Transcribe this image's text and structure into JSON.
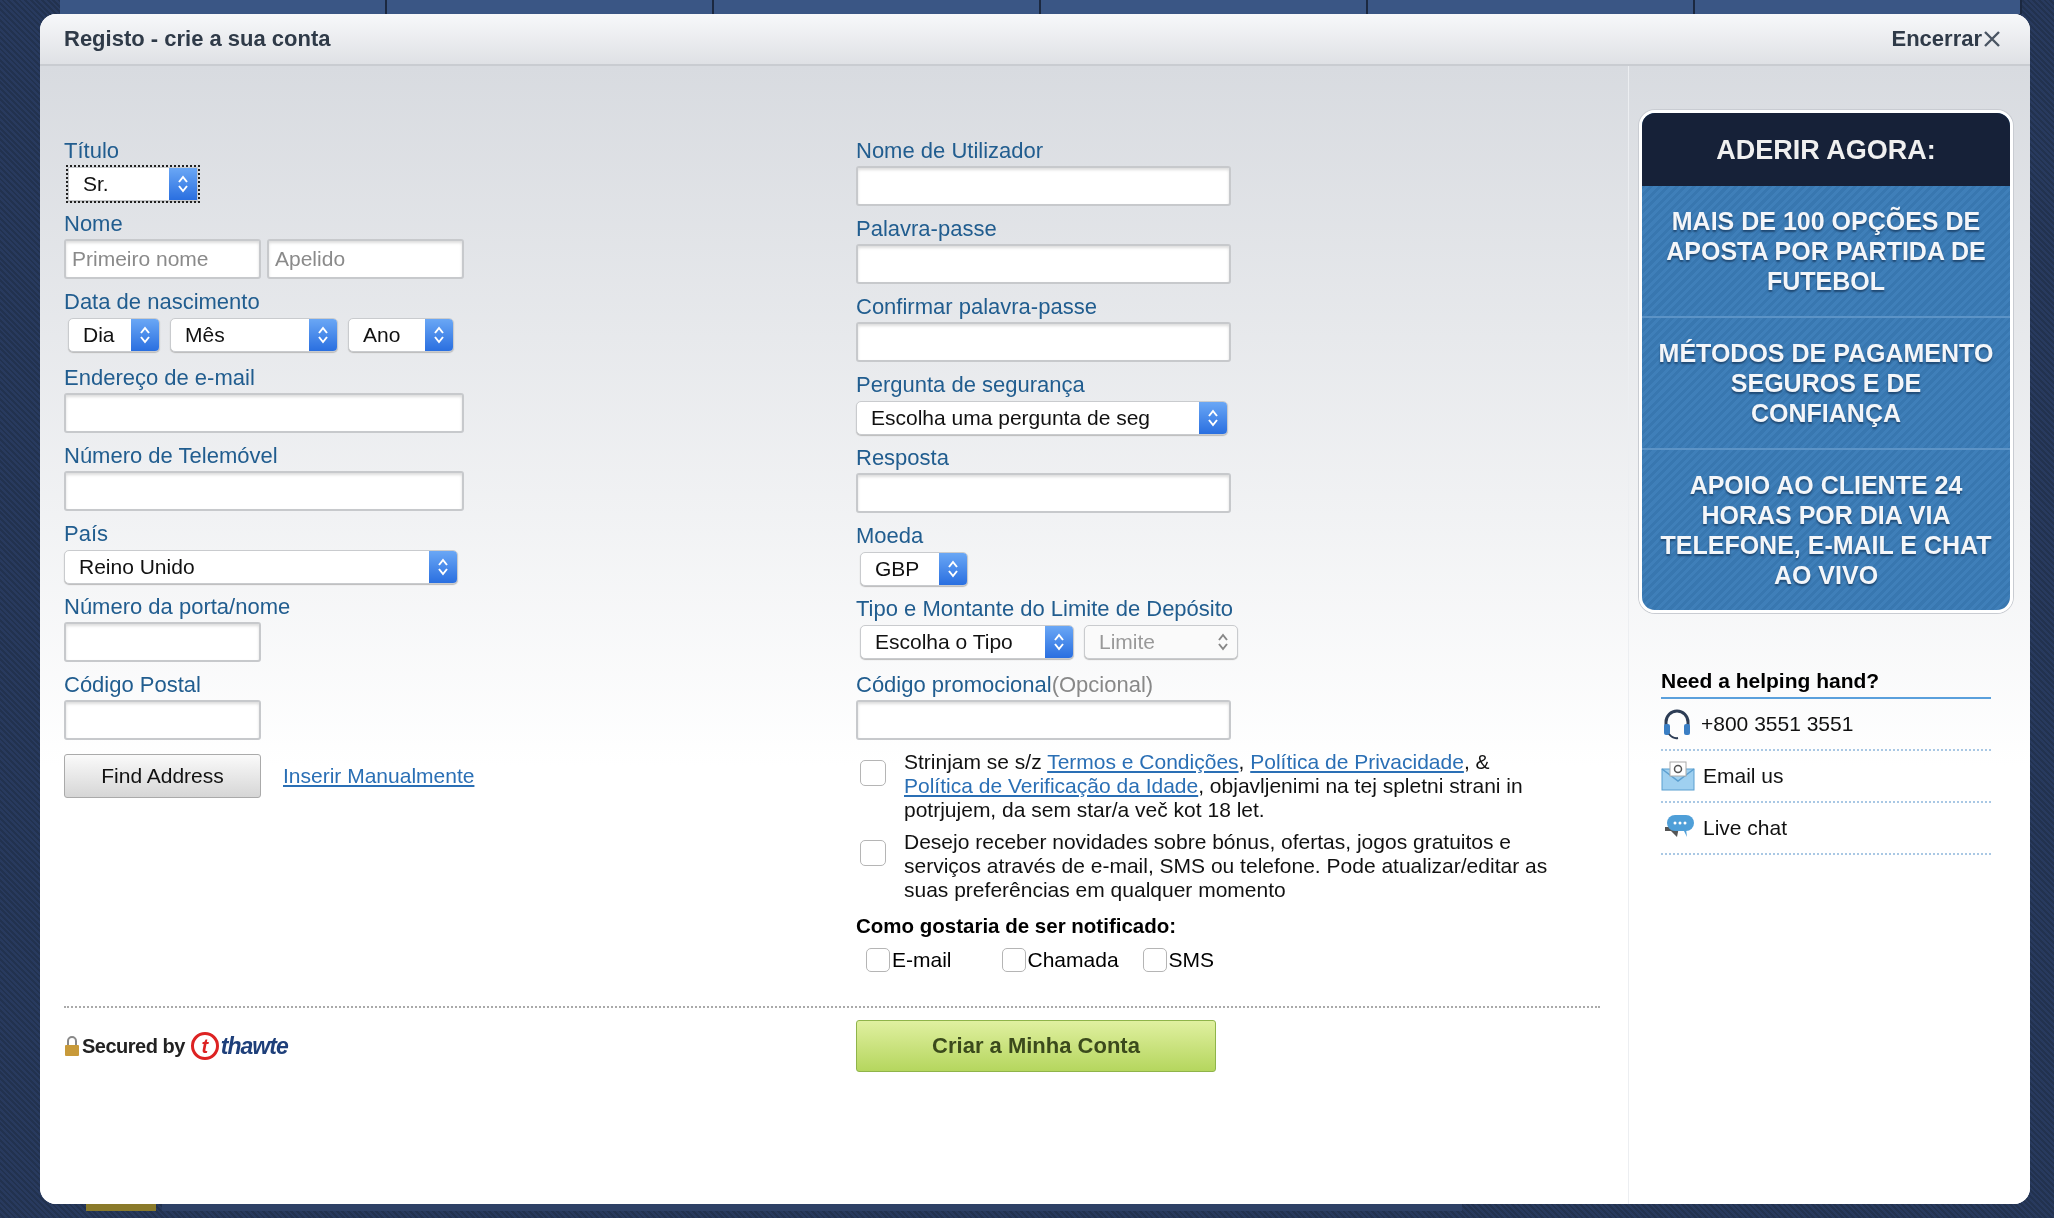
{
  "dialog": {
    "title": "Registo - crie a sua conta",
    "close": "Encerrar"
  },
  "left_fields": [
    {
      "kind": "short-select",
      "label": "Título",
      "value": "Sr.",
      "focused": true
    },
    {
      "kind": "name",
      "label": "Nome",
      "placeholders": [
        "Primeiro nome",
        "Apelido"
      ]
    },
    {
      "kind": "date",
      "label": "Data de nascimento",
      "values": [
        "Dia",
        "Mês",
        "Ano"
      ]
    },
    {
      "kind": "text",
      "label": "Endereço de e-mail"
    },
    {
      "kind": "text",
      "label": "Número de Telemóvel"
    },
    {
      "kind": "wide-select",
      "label": "País",
      "value": "Reino Unido"
    },
    {
      "kind": "short-text",
      "label": "Número da porta/nome"
    },
    {
      "kind": "short-text",
      "label": "Código Postal"
    }
  ],
  "find_address": "Find Address",
  "manual_link": "Inserir Manualmente",
  "right_fields": [
    {
      "kind": "text",
      "label": "Nome de Utilizador"
    },
    {
      "kind": "text",
      "label": "Palavra-passe"
    },
    {
      "kind": "text",
      "label": "Confirmar palavra-passe"
    },
    {
      "kind": "wide-select",
      "label": "Pergunta de segurança",
      "value": "Escolha uma pergunta de seg"
    },
    {
      "kind": "text",
      "label": "Resposta"
    },
    {
      "kind": "short-select",
      "label": "Moeda",
      "value": "GBP"
    },
    {
      "kind": "limit",
      "label": "Tipo e Montante do Limite de Depósito",
      "selects": [
        {
          "value": "Escolha o Tipo",
          "disabled": false
        },
        {
          "placeholder": "Limite",
          "disabled": true
        }
      ]
    },
    {
      "kind": "text",
      "label": "Código promocional",
      "optional": "(Opcional)"
    }
  ],
  "consents": [
    {
      "checked": false,
      "parts": [
        {
          "text": "Strinjam se s/z "
        },
        {
          "link": "Termos e Condições"
        },
        {
          "text": ", "
        },
        {
          "link": "Política de Privacidade"
        },
        {
          "text": ", & "
        },
        {
          "link": "Política de Verificação da Idade"
        },
        {
          "text": ", objavljenimi na tej spletni strani in potrjujem, da sem star/a več kot 18 let."
        }
      ]
    },
    {
      "checked": false,
      "parts": [
        {
          "text": "Desejo receber novidades sobre bónus, ofertas, jogos gratuitos e serviços através de e-mail, SMS ou telefone. Pode atualizar/editar as suas preferências em qualquer momento"
        }
      ]
    }
  ],
  "notify": {
    "title": "Como gostaria de ser notificado:",
    "options": [
      {
        "label": "E-mail",
        "checked": false
      },
      {
        "label": "Chamada",
        "checked": false
      },
      {
        "label": "SMS",
        "checked": false
      }
    ]
  },
  "secured": {
    "text": "Secured by",
    "mark": "t",
    "brand": "thawte"
  },
  "submit": "Criar a Minha Conta",
  "side": {
    "heading": "ADERIR AGORA:",
    "benefits": [
      "MAIS DE 100 OPÇÕES DE APOSTA POR PARTIDA DE FUTEBOL",
      "MÉTODOS DE PAGAMENTO SEGUROS E DE CONFIANÇA",
      "APOIO AO CLIENTE 24 HORAS POR DIA VIA TELEFONE, E-MAIL E CHAT AO VIVO"
    ],
    "help_title": "Need a helping hand?",
    "help": [
      {
        "kind": "phone",
        "label": "+800 3551 3551"
      },
      {
        "kind": "email",
        "label": "Email us"
      },
      {
        "kind": "chat",
        "label": "Live chat"
      }
    ]
  }
}
